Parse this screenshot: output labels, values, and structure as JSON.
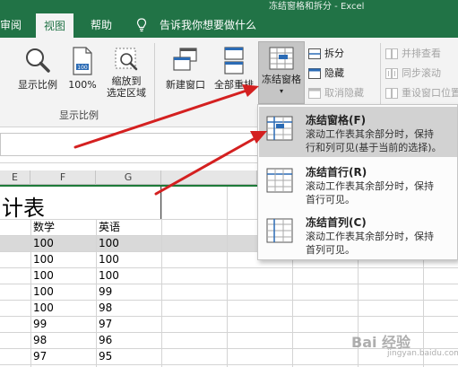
{
  "window": {
    "title": "冻结窗格和拆分 - Excel"
  },
  "tabs": [
    {
      "label": "审阅"
    },
    {
      "label": "视图"
    },
    {
      "label": "帮助"
    }
  ],
  "tell_me": {
    "label": "告诉我你想要做什么"
  },
  "ribbon": {
    "show_ratio": {
      "label": "显示比例"
    },
    "zoom_100": {
      "label": "100%"
    },
    "zoom_selection": {
      "line1": "缩放到",
      "line2": "选定区域"
    },
    "group_zoom_label": "显示比例",
    "new_window": {
      "label": "新建窗口"
    },
    "arrange_all": {
      "label": "全部重排"
    },
    "freeze_panes": {
      "label": "冻结窗格"
    },
    "split": {
      "label": "拆分"
    },
    "hide": {
      "label": "隐藏"
    },
    "unhide": {
      "label": "取消隐藏"
    },
    "side_by_side": {
      "label": "并排查看"
    },
    "sync_scroll": {
      "label": "同步滚动"
    },
    "reset_window": {
      "label": "重设窗口位置"
    }
  },
  "menu": {
    "items": [
      {
        "title": "冻结窗格(F)",
        "desc_line1": "滚动工作表其余部分时，保持",
        "desc_line2": "行和列可见(基于当前的选择)。"
      },
      {
        "title": "冻结首行(R)",
        "desc_line1": "滚动工作表其余部分时，保持",
        "desc_line2": "首行可见。"
      },
      {
        "title": "冻结首列(C)",
        "desc_line1": "滚动工作表其余部分时，保持",
        "desc_line2": "首列可见。"
      }
    ]
  },
  "sheet": {
    "columns": [
      "E",
      "F",
      "G"
    ],
    "title_fragment": "计表",
    "headers": [
      "数学",
      "英语"
    ],
    "rows": [
      [
        "100",
        "100"
      ],
      [
        "100",
        "100"
      ],
      [
        "100",
        "100"
      ],
      [
        "100",
        "99"
      ],
      [
        "100",
        "98"
      ],
      [
        "99",
        "97"
      ],
      [
        "98",
        "96"
      ],
      [
        "97",
        "95"
      ]
    ]
  },
  "watermark": {
    "brand": "Bai 经验",
    "url": "jingyan.baidu.com"
  },
  "colors": {
    "excel_green": "#217346",
    "freeze_line": "#1e7b3a",
    "arrow_red": "#d42020"
  }
}
